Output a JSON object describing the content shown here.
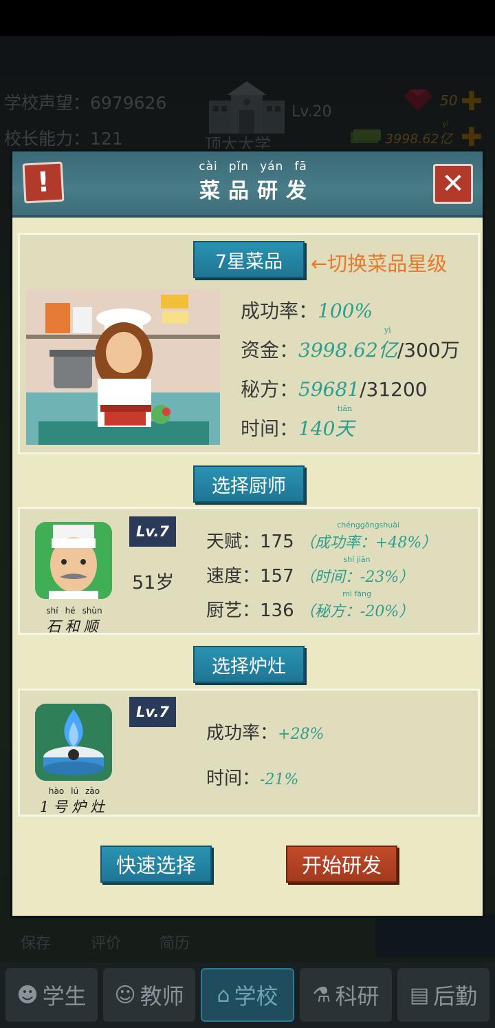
{
  "background": {
    "reputation_label": "学校声望：",
    "reputation_value": "6979626",
    "ability_label": "校长能力：",
    "ability_value": "121",
    "school_level": "Lv.20",
    "school_name": "顶大大学",
    "gems": "50",
    "cash": "3998.62",
    "cash_unit_pinyin": "yì",
    "cash_unit": "亿",
    "under_buttons": [
      "保存",
      "评价",
      "简历"
    ],
    "nav": [
      {
        "label": "学生",
        "icon": "student-icon"
      },
      {
        "label": "教师",
        "icon": "teacher-icon"
      },
      {
        "label": "学校",
        "icon": "school-icon",
        "active": true
      },
      {
        "label": "科研",
        "icon": "flask-icon"
      },
      {
        "label": "后勤",
        "icon": "clipboard-icon"
      }
    ]
  },
  "dialog": {
    "title_pinyin": [
      "cài",
      "pǐn",
      "yán",
      "fā"
    ],
    "title": [
      "菜",
      "品",
      "研",
      "发"
    ],
    "alert_glyph": "!",
    "close_glyph": "✕",
    "star_button": "7星菜品",
    "star_hint": "←切换菜品星级",
    "recipe": {
      "success_label": "成功率：",
      "success_value": "100%",
      "funds_label": "资金：",
      "funds_value": "3998.62",
      "funds_unit_pinyin": "yì",
      "funds_unit": "亿",
      "funds_required": "/300万",
      "secret_label": "秘方：",
      "secret_value": "59681",
      "secret_required": "/31200",
      "time_label": "时间：",
      "time_value": "140",
      "time_unit_pinyin": "tiān",
      "time_unit": "天"
    },
    "chef_button": "选择厨师",
    "chef": {
      "level": "Lv.7",
      "age": "51岁",
      "name_pinyin": [
        "shí",
        "hé",
        "shùn"
      ],
      "name": "石和顺",
      "talent_label": "天赋：",
      "talent_value": "175",
      "talent_bonus_pinyin": "chénggōngshuài",
      "talent_bonus": "（成功率：+48%）",
      "speed_label": "速度：",
      "speed_value": "157",
      "speed_bonus_pinyin": "shí jiān",
      "speed_bonus": "（时间：-23%）",
      "skill_label": "厨艺：",
      "skill_value": "136",
      "skill_bonus_pinyin": "mì fāng",
      "skill_bonus": "（秘方：-20%）"
    },
    "stove_button": "选择炉灶",
    "stove": {
      "level": "Lv.7",
      "name_pinyin": [
        "hào",
        "lú",
        "zào"
      ],
      "name": "1号炉灶",
      "success_label": "成功率：",
      "success_bonus": "+28%",
      "time_label": "时间：",
      "time_bonus": "-21%"
    },
    "quick_select": "快速选择",
    "start_research": "开始研发",
    "colors": {
      "header": "#487c88",
      "panel": "#e0ddbd",
      "blue_button": "#1f7594",
      "red_button": "#a23a1e",
      "hint": "#e8782b",
      "highlight": "#2c9e8e"
    }
  }
}
